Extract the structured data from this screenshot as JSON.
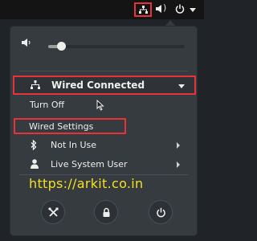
{
  "topbar": {
    "network_icon": "network-wired-icon",
    "volume_icon": "volume-icon",
    "power_icon": "power-icon",
    "menu_arrow_icon": "chevron-down-icon"
  },
  "menu": {
    "volume_slider": {
      "icon": "volume-low-icon",
      "level": 0.08
    },
    "wired": {
      "label": "Wired Connected",
      "icon": "network-wired-icon",
      "expanded": true,
      "items": [
        {
          "label": "Turn Off"
        },
        {
          "label": "Wired Settings"
        }
      ]
    },
    "bluetooth": {
      "label": "Not In Use",
      "icon": "bluetooth-icon"
    },
    "user": {
      "label": "Live System User",
      "icon": "user-icon"
    },
    "actions": [
      {
        "name": "settings",
        "icon": "settings-tools-icon"
      },
      {
        "name": "lock",
        "icon": "lock-icon"
      },
      {
        "name": "power",
        "icon": "power-icon"
      }
    ]
  },
  "watermark": {
    "text": "https://arkit.co.in"
  },
  "colors": {
    "highlight": "#e8323a",
    "watermark": "#f5e01e",
    "panel": "#363b40"
  }
}
